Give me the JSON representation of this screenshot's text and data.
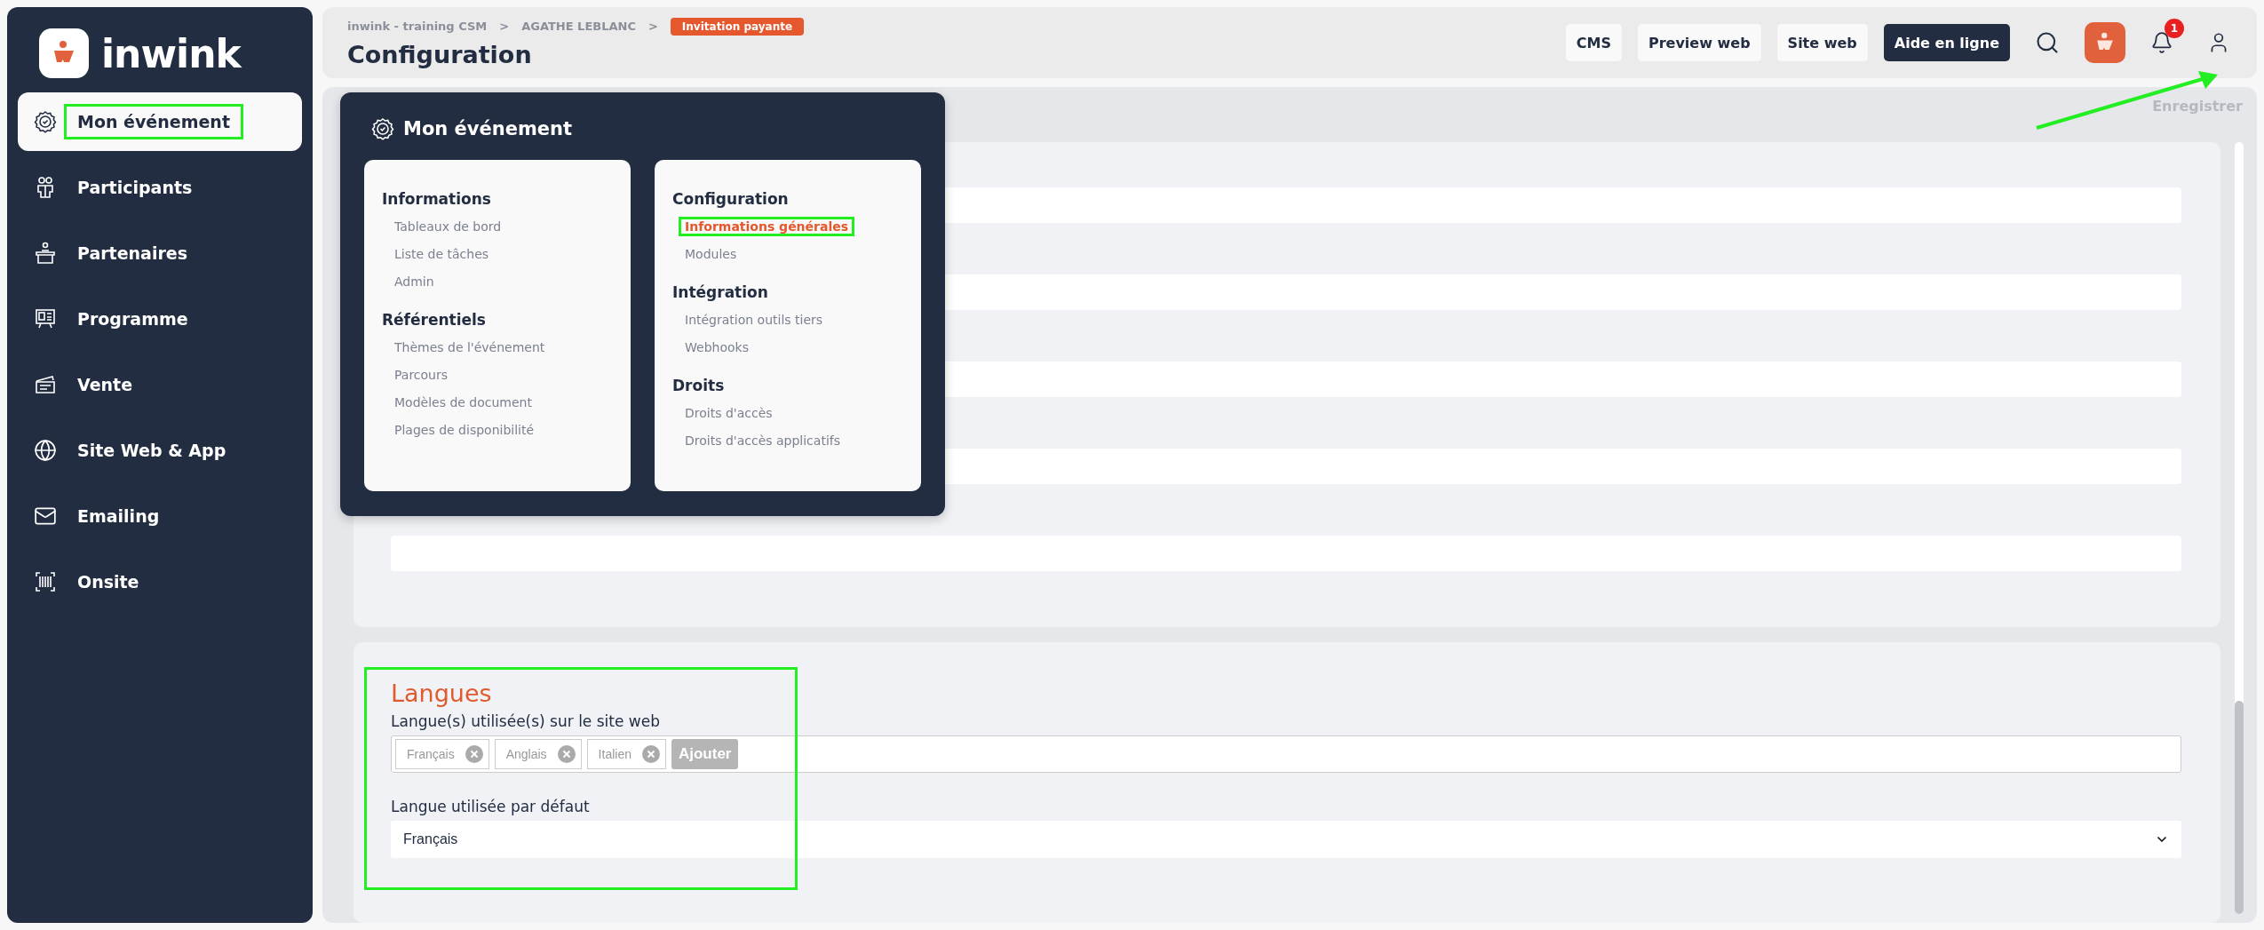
{
  "sidebar": {
    "logo_text": "inwink",
    "items": [
      {
        "label": "Mon événement",
        "kind": "badge",
        "selected": true,
        "highlighted": true
      },
      {
        "label": "Participants",
        "kind": "people",
        "selected": false,
        "highlighted": false
      },
      {
        "label": "Partenaires",
        "kind": "podium",
        "selected": false,
        "highlighted": false
      },
      {
        "label": "Programme",
        "kind": "board",
        "selected": false,
        "highlighted": false
      },
      {
        "label": "Vente",
        "kind": "ticket",
        "selected": false,
        "highlighted": false
      },
      {
        "label": "Site Web & App",
        "kind": "globe",
        "selected": false,
        "highlighted": false
      },
      {
        "label": "Emailing",
        "kind": "mail",
        "selected": false,
        "highlighted": false
      },
      {
        "label": "Onsite",
        "kind": "barcode",
        "selected": false,
        "highlighted": false
      }
    ]
  },
  "header": {
    "breadcrumb": [
      "inwink - training CSM",
      ">",
      "AGATHE LEBLANC",
      ">"
    ],
    "badge": "Invitation payante",
    "title": "Configuration",
    "buttons": [
      {
        "label": "CMS",
        "kind": "light"
      },
      {
        "label": "Preview web",
        "kind": "light"
      },
      {
        "label": "Site web",
        "kind": "light"
      },
      {
        "label": "Aide en ligne",
        "kind": "dark"
      }
    ],
    "notification_count": "1"
  },
  "toolbar": {
    "save_label": "Enregistrer",
    "disabled": true
  },
  "general_form": {
    "fields": [
      {
        "kind": "text"
      },
      {
        "kind": "text"
      },
      {
        "kind": "text"
      },
      {
        "kind": "text"
      },
      {
        "kind": "text"
      }
    ]
  },
  "menu": {
    "title": "Mon événement",
    "columns": [
      {
        "groups": [
          {
            "heading": "Informations",
            "links": [
              {
                "label": "Tableaux de bord",
                "selected": false,
                "highlighted": false
              },
              {
                "label": "Liste de tâches",
                "selected": false,
                "highlighted": false
              },
              {
                "label": "Admin",
                "selected": false,
                "highlighted": false
              }
            ]
          },
          {
            "heading": "Référentiels",
            "links": [
              {
                "label": "Thèmes de l'événement",
                "selected": false,
                "highlighted": false
              },
              {
                "label": "Parcours",
                "selected": false,
                "highlighted": false
              },
              {
                "label": "Modèles de document",
                "selected": false,
                "highlighted": false
              },
              {
                "label": "Plages de disponibilité",
                "selected": false,
                "highlighted": false
              }
            ]
          }
        ]
      },
      {
        "groups": [
          {
            "heading": "Configuration",
            "links": [
              {
                "label": "Informations générales",
                "selected": true,
                "highlighted": true
              },
              {
                "label": "Modules",
                "selected": false,
                "highlighted": false
              }
            ]
          },
          {
            "heading": "Intégration",
            "links": [
              {
                "label": "Intégration outils tiers",
                "selected": false,
                "highlighted": false
              },
              {
                "label": "Webhooks",
                "selected": false,
                "highlighted": false
              }
            ]
          },
          {
            "heading": "Droits",
            "links": [
              {
                "label": "Droits d'accès",
                "selected": false,
                "highlighted": false
              },
              {
                "label": "Droits d'accès applicatifs",
                "selected": false,
                "highlighted": false
              }
            ]
          }
        ]
      }
    ]
  },
  "languages": {
    "title": "Langues",
    "highlighted": true,
    "used_label": "Langue(s) utilisée(s) sur le site web",
    "tags": [
      "Français",
      "Anglais",
      "Italien"
    ],
    "add_button": "Ajouter",
    "default_label": "Langue utilisée par défaut",
    "default_value": "Français"
  }
}
